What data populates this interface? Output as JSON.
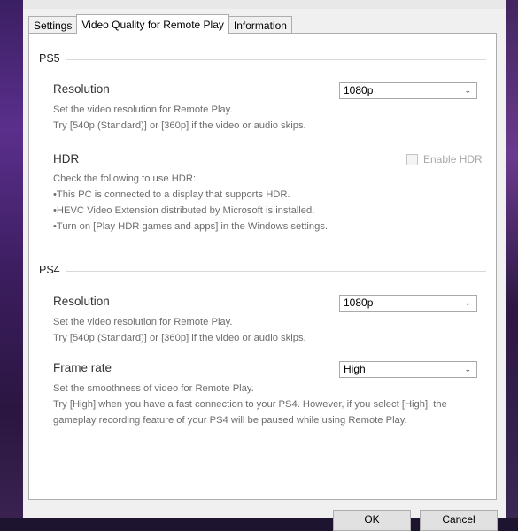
{
  "tabs": [
    "Settings",
    "Video Quality for Remote Play",
    "Information"
  ],
  "ps5": {
    "heading": "PS5",
    "resolution": {
      "label": "Resolution",
      "value": "1080p",
      "desc1": "Set the video resolution for Remote Play.",
      "desc2": "Try [540p (Standard)] or [360p] if the video or audio skips."
    },
    "hdr": {
      "label": "HDR",
      "checkbox_label": "Enable HDR",
      "checked": false,
      "desc1": "Check the following to use HDR:",
      "desc2": "•This PC is connected to a display that supports HDR.",
      "desc3": "•HEVC Video Extension distributed by Microsoft is installed.",
      "desc4": "•Turn on [Play HDR games and apps] in the Windows settings."
    }
  },
  "ps4": {
    "heading": "PS4",
    "resolution": {
      "label": "Resolution",
      "value": "1080p",
      "desc1": "Set the video resolution for Remote Play.",
      "desc2": "Try [540p (Standard)] or [360p] if the video or audio skips."
    },
    "frame_rate": {
      "label": "Frame rate",
      "value": "High",
      "desc1": "Set the smoothness of video for Remote Play.",
      "desc2": "Try [High] when you have a fast connection to your PS4. However, if you select [High], the",
      "desc3": "gameplay recording feature of your PS4 will be paused while using Remote Play."
    }
  },
  "buttons": {
    "ok": "OK",
    "cancel": "Cancel"
  }
}
